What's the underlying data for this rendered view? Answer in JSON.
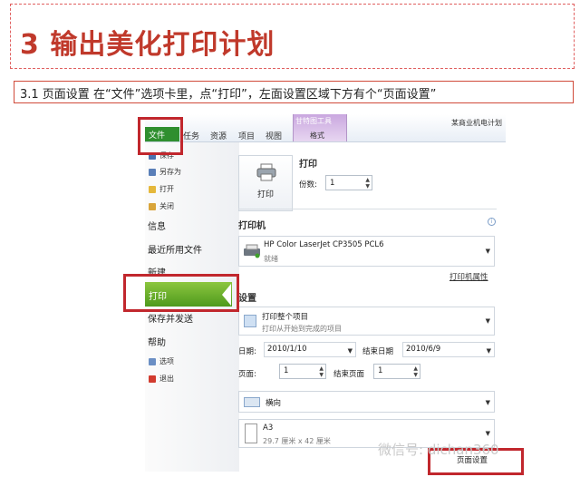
{
  "header": {
    "title": "3 输出美化打印计划",
    "caption": "3.1 页面设置 在“文件”选项卡里，点“打印”，左面设置区域下方有个“页面设置”"
  },
  "ribbon": {
    "doc_title": "某商业机电计划",
    "tool_group": "甘特图工具",
    "tool_tab": "格式",
    "tabs": [
      "文件",
      "任务",
      "资源",
      "项目",
      "视图"
    ]
  },
  "left_pane": {
    "small_items": [
      "保存",
      "另存为",
      "打开",
      "关闭"
    ],
    "big_items": [
      "信息",
      "最近所用文件",
      "新建",
      "打印",
      "保存并发送",
      "帮助"
    ],
    "bottom_items": [
      "选项",
      "退出"
    ]
  },
  "print": {
    "section": "打印",
    "button": "打印",
    "copies_label": "份数:",
    "copies_value": "1"
  },
  "printer": {
    "section": "打印机",
    "name": "HP Color LaserJet CP3505 PCL6",
    "status": "就绪",
    "properties_link": "打印机属性"
  },
  "settings": {
    "section": "设置",
    "scope_title": "打印整个项目",
    "scope_sub": "打印从开始到完成的项目",
    "date_label": "日期:",
    "date_start": "2010/1/10",
    "end_date_label": "结束日期",
    "date_end": "2010/6/9",
    "page_label": "页面:",
    "page_from": "1",
    "end_page_label": "结束页面",
    "page_to": "1",
    "orientation": "横向",
    "paper_name": "A3",
    "paper_size": "29.7 厘米 x 42 厘米",
    "page_setup_link": "页面设置"
  },
  "watermark": "微信号: dichan360"
}
